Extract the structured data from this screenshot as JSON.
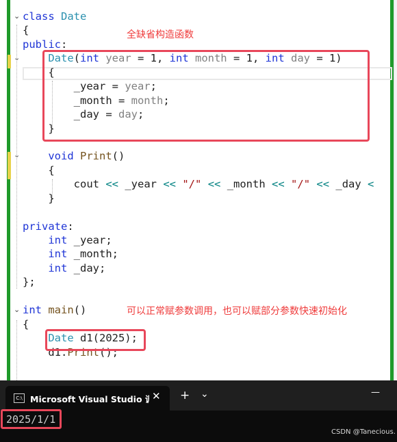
{
  "editor": {
    "code_lines": [
      [
        {
          "t": "class ",
          "c": "kw"
        },
        {
          "t": "Date",
          "c": "ty"
        }
      ],
      [
        {
          "t": "{",
          "c": ""
        }
      ],
      [
        {
          "t": "public",
          "c": "kw"
        },
        {
          "t": ":",
          "c": ""
        }
      ],
      [
        {
          "t": "    ",
          "c": ""
        },
        {
          "t": "Date",
          "c": "ty"
        },
        {
          "t": "(",
          "c": ""
        },
        {
          "t": "int ",
          "c": "kw"
        },
        {
          "t": "year",
          "c": "pm"
        },
        {
          "t": " = 1, ",
          "c": ""
        },
        {
          "t": "int ",
          "c": "kw"
        },
        {
          "t": "month",
          "c": "pm"
        },
        {
          "t": " = 1, ",
          "c": ""
        },
        {
          "t": "int ",
          "c": "kw"
        },
        {
          "t": "day",
          "c": "pm"
        },
        {
          "t": " = 1)",
          "c": ""
        }
      ],
      [
        {
          "t": "    {",
          "c": ""
        }
      ],
      [
        {
          "t": "        _year = ",
          "c": ""
        },
        {
          "t": "year",
          "c": "pm"
        },
        {
          "t": ";",
          "c": ""
        }
      ],
      [
        {
          "t": "        _month = ",
          "c": ""
        },
        {
          "t": "month",
          "c": "pm"
        },
        {
          "t": ";",
          "c": ""
        }
      ],
      [
        {
          "t": "        _day = ",
          "c": ""
        },
        {
          "t": "day",
          "c": "pm"
        },
        {
          "t": ";",
          "c": ""
        }
      ],
      [
        {
          "t": "    }",
          "c": ""
        }
      ],
      [
        {
          "t": "",
          "c": ""
        }
      ],
      [
        {
          "t": "    ",
          "c": ""
        },
        {
          "t": "void ",
          "c": "kw"
        },
        {
          "t": "Print",
          "c": "fn"
        },
        {
          "t": "()",
          "c": ""
        }
      ],
      [
        {
          "t": "    {",
          "c": ""
        }
      ],
      [
        {
          "t": "        cout ",
          "c": ""
        },
        {
          "t": "<<",
          "c": "op"
        },
        {
          "t": " _year ",
          "c": ""
        },
        {
          "t": "<<",
          "c": "op"
        },
        {
          "t": " ",
          "c": ""
        },
        {
          "t": "\"/\"",
          "c": "st"
        },
        {
          "t": " ",
          "c": ""
        },
        {
          "t": "<<",
          "c": "op"
        },
        {
          "t": " _month ",
          "c": ""
        },
        {
          "t": "<<",
          "c": "op"
        },
        {
          "t": " ",
          "c": ""
        },
        {
          "t": "\"/\"",
          "c": "st"
        },
        {
          "t": " ",
          "c": ""
        },
        {
          "t": "<<",
          "c": "op"
        },
        {
          "t": " _day ",
          "c": ""
        },
        {
          "t": "<",
          "c": "op"
        }
      ],
      [
        {
          "t": "    }",
          "c": ""
        }
      ],
      [
        {
          "t": "",
          "c": ""
        }
      ],
      [
        {
          "t": "private",
          "c": "kw"
        },
        {
          "t": ":",
          "c": ""
        }
      ],
      [
        {
          "t": "    ",
          "c": ""
        },
        {
          "t": "int ",
          "c": "kw"
        },
        {
          "t": "_year;",
          "c": ""
        }
      ],
      [
        {
          "t": "    ",
          "c": ""
        },
        {
          "t": "int ",
          "c": "kw"
        },
        {
          "t": "_month;",
          "c": ""
        }
      ],
      [
        {
          "t": "    ",
          "c": ""
        },
        {
          "t": "int ",
          "c": "kw"
        },
        {
          "t": "_day;",
          "c": ""
        }
      ],
      [
        {
          "t": "};",
          "c": ""
        }
      ],
      [
        {
          "t": "",
          "c": ""
        }
      ],
      [
        {
          "t": "int ",
          "c": "kw"
        },
        {
          "t": "main",
          "c": "fn"
        },
        {
          "t": "()",
          "c": ""
        }
      ],
      [
        {
          "t": "{",
          "c": ""
        }
      ],
      [
        {
          "t": "    ",
          "c": ""
        },
        {
          "t": "Date",
          "c": "ty"
        },
        {
          "t": " d1(2025);",
          "c": ""
        }
      ],
      [
        {
          "t": "    d1.",
          "c": ""
        },
        {
          "t": "Print",
          "c": "fn"
        },
        {
          "t": "();",
          "c": ""
        }
      ]
    ],
    "annotation_constructor": "全缺省构造函数",
    "annotation_main": "可以正常赋参数调用，也可以赋部分参数快速初始化"
  },
  "terminal": {
    "tab_title": "Microsoft Visual Studio 调试控制台",
    "tab_icon_label": "C:\\",
    "close_glyph": "✕",
    "new_tab_glyph": "+",
    "dropdown_glyph": "⌄",
    "minimize_glyph": "—",
    "output": "2025/1/1"
  },
  "watermark": "CSDN @Tanecious."
}
